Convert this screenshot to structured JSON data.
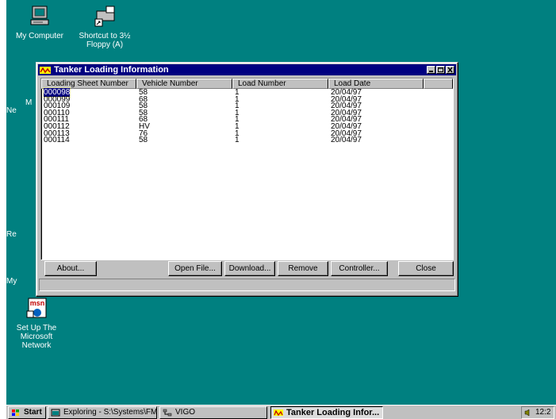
{
  "desktop": {
    "icons": [
      {
        "label": "My Computer",
        "icon": "my-computer-icon"
      },
      {
        "label": "Shortcut to 3½ Floppy (A)",
        "icon": "floppy-shortcut-icon"
      },
      {
        "label": "Set Up The Microsoft Network",
        "icon": "msn-icon"
      }
    ],
    "partial_labels": [
      "M",
      "Ne",
      "Re",
      "My"
    ]
  },
  "window": {
    "title": "Tanker Loading Information",
    "columns": [
      "Loading Sheet Number",
      "Vehicle Number",
      "Load Number",
      "Load Date"
    ],
    "rows": [
      {
        "sheet": "000098",
        "vehicle": "58",
        "load": "1",
        "date": "20/04/97"
      },
      {
        "sheet": "000099",
        "vehicle": "68",
        "load": "1",
        "date": "20/04/97"
      },
      {
        "sheet": "000109",
        "vehicle": "58",
        "load": "1",
        "date": "20/04/97"
      },
      {
        "sheet": "000110",
        "vehicle": "58",
        "load": "1",
        "date": "20/04/97"
      },
      {
        "sheet": "000111",
        "vehicle": "68",
        "load": "1",
        "date": "20/04/97"
      },
      {
        "sheet": "000112",
        "vehicle": "HV",
        "load": "1",
        "date": "20/04/97"
      },
      {
        "sheet": "000113",
        "vehicle": "76",
        "load": "1",
        "date": "20/04/97"
      },
      {
        "sheet": "000114",
        "vehicle": "58",
        "load": "1",
        "date": "20/04/97"
      }
    ],
    "selected_row": 0,
    "buttons": {
      "about": "About...",
      "open_file": "Open File...",
      "download": "Download...",
      "remove": "Remove",
      "controller": "Controller...",
      "close": "Close"
    },
    "status": ""
  },
  "taskbar": {
    "start": "Start",
    "tasks": [
      {
        "label": "Exploring - S:\\Systems\\FM...",
        "icon": "explorer-icon",
        "active": false
      },
      {
        "label": "VIGO",
        "icon": "network-icon",
        "active": false
      },
      {
        "label": "Tanker Loading Infor...",
        "icon": "tanker-app-icon",
        "active": true
      }
    ],
    "clock": "12:2"
  },
  "colors": {
    "desktop": "#008080",
    "title_bar": "#000080",
    "face": "#c0c0c0",
    "selection": "#000080"
  }
}
